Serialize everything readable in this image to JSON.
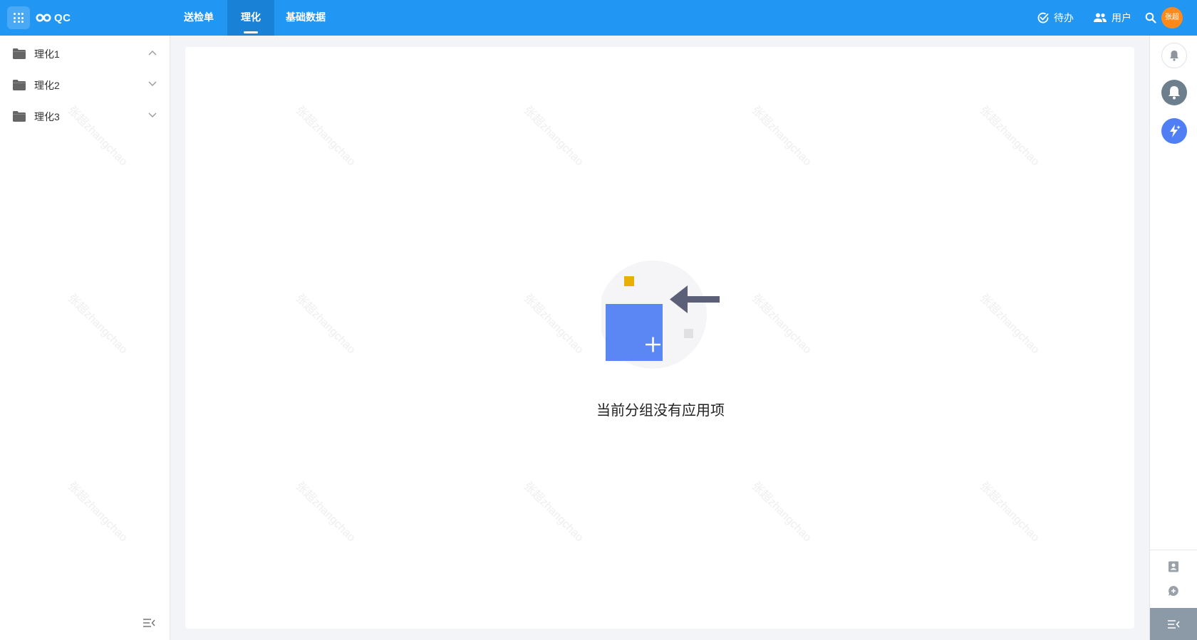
{
  "header": {
    "app_name": "QC",
    "tabs": [
      {
        "label": "送检单",
        "active": false
      },
      {
        "label": "理化",
        "active": true
      },
      {
        "label": "基础数据",
        "active": false
      }
    ],
    "todo_label": "待办",
    "users_label": "用户",
    "avatar_text": "张超"
  },
  "sidebar": {
    "items": [
      {
        "label": "理化1",
        "expanded": true
      },
      {
        "label": "理化2",
        "expanded": false
      },
      {
        "label": "理化3",
        "expanded": false
      }
    ]
  },
  "main": {
    "empty_text": "当前分组没有应用项"
  },
  "watermark": "张超zhangchao",
  "colors": {
    "primary": "#2196f3",
    "active_tab": "#1a82d6",
    "avatar": "#ff8a1a",
    "illustration_blue": "#5b87f5",
    "illustration_yellow": "#e8b007"
  }
}
